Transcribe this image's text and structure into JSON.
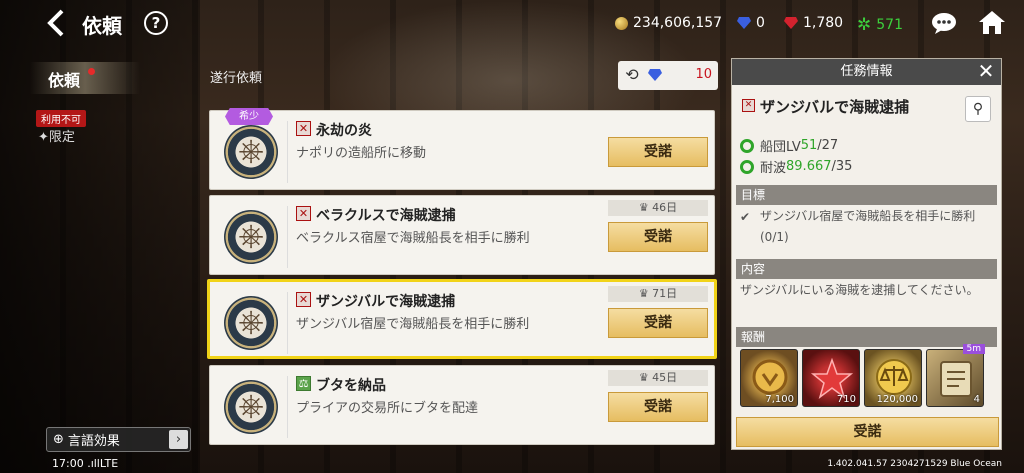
{
  "header": {
    "title": "依頼",
    "help": "?",
    "currencies": [
      {
        "icon": "gold-coin-icon",
        "value": "234,606,157"
      },
      {
        "icon": "blue-gem-icon",
        "value": "0"
      },
      {
        "icon": "red-gem-icon",
        "value": "1,780"
      },
      {
        "icon": "green-gear-icon",
        "value": "571"
      }
    ]
  },
  "sidebar": {
    "tab_label": "依頼",
    "not_available_badge": "利用不可",
    "limited_label": "✦限定",
    "language_effect": "言語効果",
    "arrow": "›"
  },
  "list": {
    "header": "遂行依頼",
    "refresh_count": "10",
    "rare_badge": "希少",
    "items": [
      {
        "name": "永劫の炎",
        "desc": "ナポリの造船所に移動",
        "days": "",
        "accept": "受諾",
        "type": "battle",
        "rare": true
      },
      {
        "name": "ベラクルスで海賊逮捕",
        "desc": "ベラクルス宿屋で海賊船長を相手に勝利",
        "days": "46日",
        "accept": "受諾",
        "type": "battle",
        "rare": false
      },
      {
        "name": "ザンジバルで海賊逮捕",
        "desc": "ザンジバル宿屋で海賊船長を相手に勝利",
        "days": "71日",
        "accept": "受諾",
        "type": "battle",
        "rare": false
      },
      {
        "name": "ブタを納品",
        "desc": "プライアの交易所にブタを配達",
        "days": "45日",
        "accept": "受諾",
        "type": "trade",
        "rare": false
      }
    ]
  },
  "panel": {
    "header": "任務情報",
    "quest_title": "ザンジバルで海賊逮捕",
    "req1_label": "船団LV ",
    "req1_cur": "51",
    "req1_max": "/27",
    "req2_label": "耐波 ",
    "req2_cur": "89.667",
    "req2_max": "/35",
    "goal_header": "目標",
    "goal_text": "ザンジバル宿屋で海賊船長を相手に勝利(0/1)",
    "content_header": "内容",
    "content_text": "ザンジバルにいる海賊を逮捕してください。",
    "reward_header": "報酬",
    "rewards": [
      {
        "icon": "gold-medal-icon",
        "count": "7,100",
        "tag": ""
      },
      {
        "icon": "red-star-laurel-icon",
        "count": "710",
        "tag": ""
      },
      {
        "icon": "gold-scale-coin-icon",
        "count": "120,000",
        "tag": ""
      },
      {
        "icon": "scroll-map-icon",
        "count": "4",
        "tag": "5m"
      }
    ],
    "accept": "受諾"
  },
  "status_bar": {
    "time_network": "17:00 .ıllLTE",
    "version": "1.402.041.57 2304271529 Blue Ocean"
  },
  "colors": {
    "accent_gold": "#e6bd61",
    "selected_border": "#f1d318",
    "green": "#2fa52a",
    "red": "#c8141e"
  }
}
